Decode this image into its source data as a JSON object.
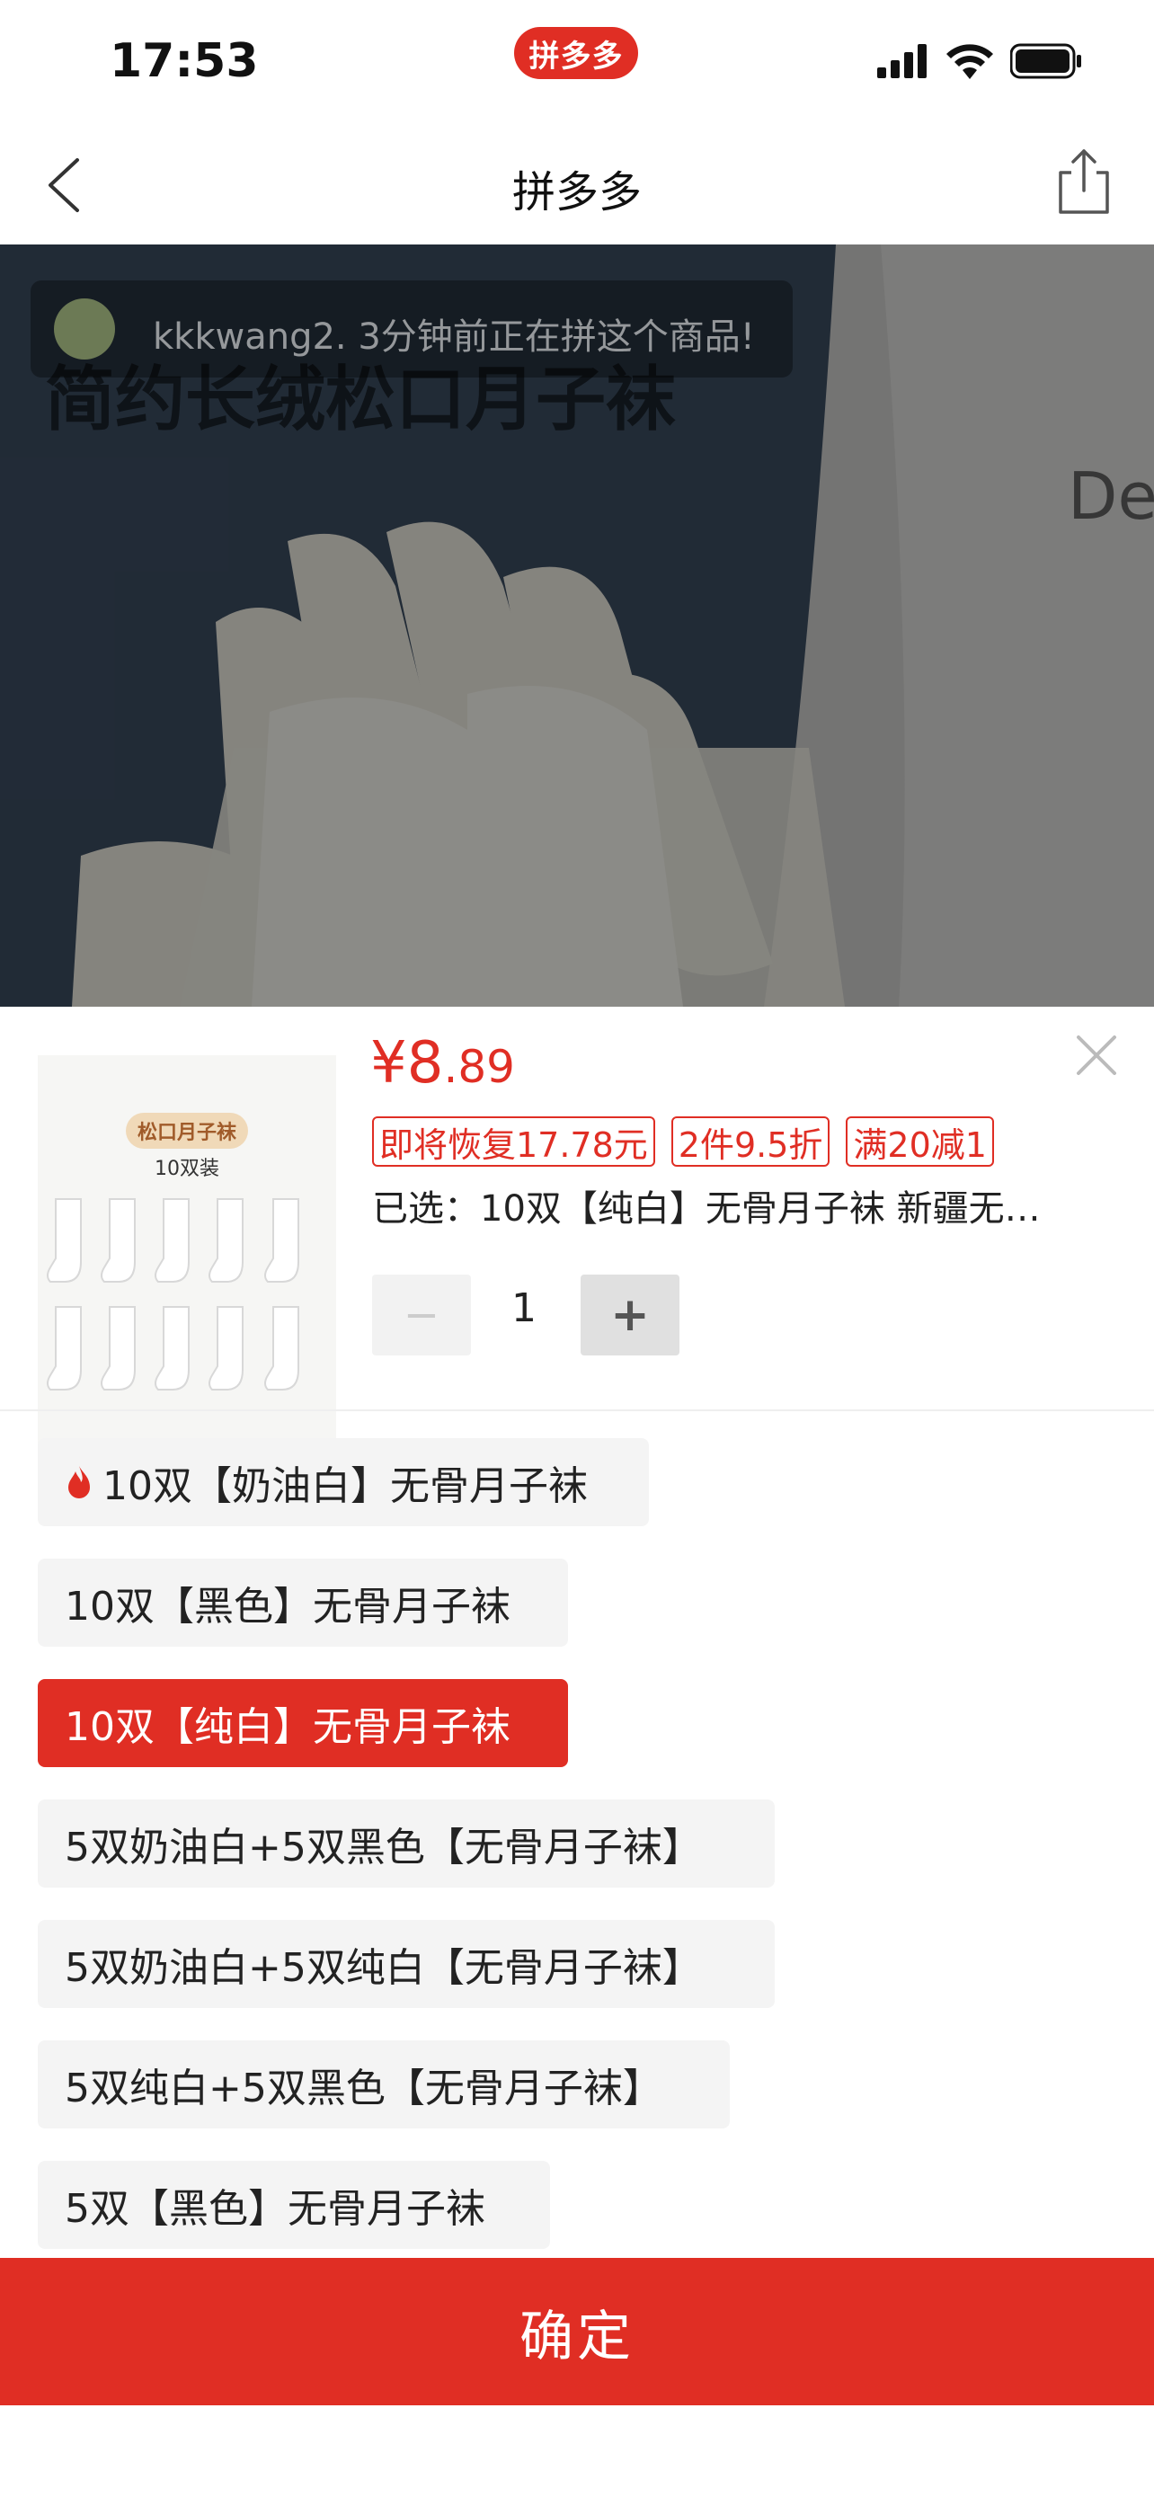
{
  "status_bar": {
    "time": "17:53",
    "app_pill": "拼多多"
  },
  "nav": {
    "title": "拼多多",
    "back_icon": "chevron-left-icon",
    "share_icon": "share-icon"
  },
  "hero": {
    "toast_text": "kkkwang2. 3分钟前正在拼这个商品!",
    "caption": "简约长绒松口月子袜",
    "brand_fragment": "De"
  },
  "product": {
    "thumb_badge": "松口月子袜",
    "thumb_sub": "10双装",
    "price_symbol": "¥",
    "price_int": "8",
    "price_dec": ".89",
    "tags": [
      "即将恢复17.78元",
      "2件9.5折",
      "满20减1"
    ],
    "selected": "已选：10双【纯白】无骨月子袜 新疆无…",
    "qty_minus": "−",
    "quantity": "1",
    "qty_plus": "+"
  },
  "options": [
    {
      "label": "10双【奶油白】无骨月子袜",
      "hot": true,
      "selected": false
    },
    {
      "label": "10双【黑色】无骨月子袜",
      "hot": false,
      "selected": false
    },
    {
      "label": "10双【纯白】无骨月子袜",
      "hot": false,
      "selected": true
    },
    {
      "label": "5双奶油白+5双黑色【无骨月子袜】",
      "hot": false,
      "selected": false
    },
    {
      "label": "5双奶油白+5双纯白【无骨月子袜】",
      "hot": false,
      "selected": false
    },
    {
      "label": "5双纯白+5双黑色【无骨月子袜】",
      "hot": false,
      "selected": false
    },
    {
      "label": "5双【黑色】无骨月子袜",
      "hot": false,
      "selected": false
    }
  ],
  "confirm_label": "确定",
  "colors": {
    "accent": "#e02e24"
  }
}
